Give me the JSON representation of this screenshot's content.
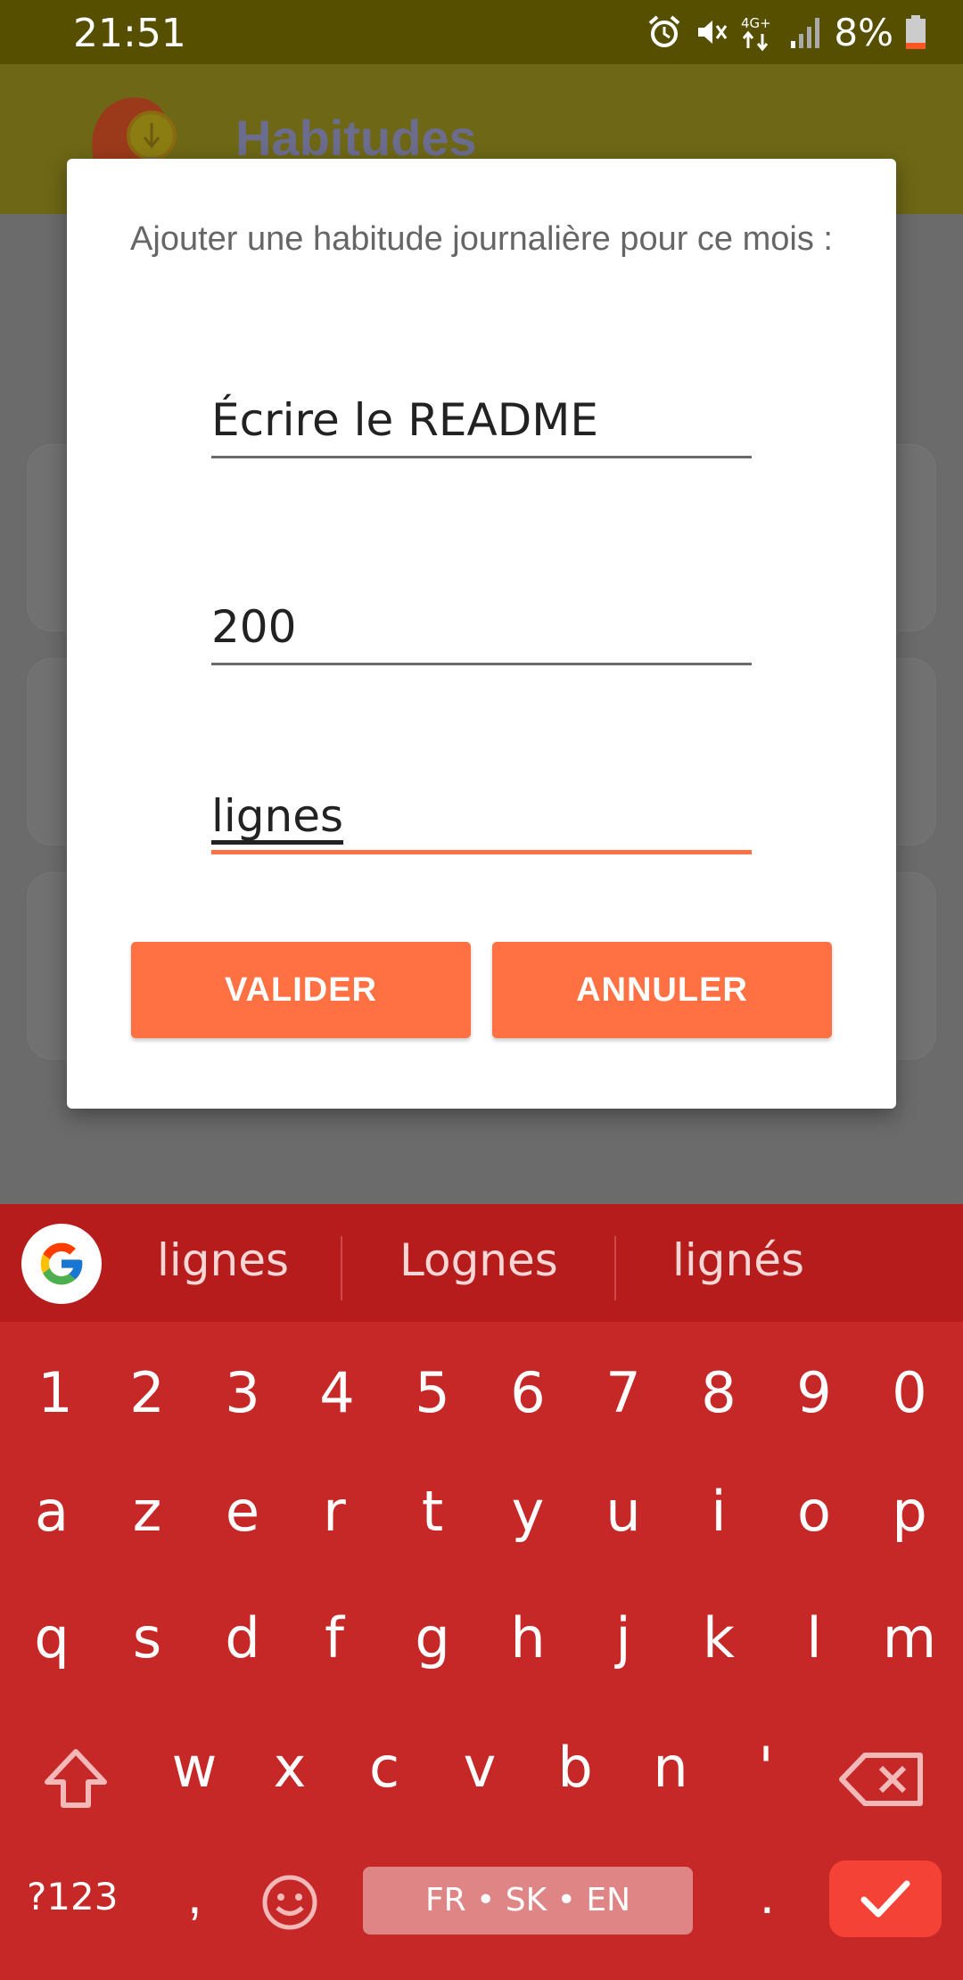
{
  "status_bar": {
    "time": "21:51",
    "network": "4G+",
    "battery": "8%"
  },
  "app_bar": {
    "title": "Habitudes"
  },
  "dialog": {
    "message": "Ajouter une habitude journalière pour ce mois :",
    "fields": [
      {
        "name": "habit-name",
        "value": "Écrire le README",
        "active": false
      },
      {
        "name": "habit-target",
        "value": "200",
        "active": false
      },
      {
        "name": "habit-unit",
        "value": "lignes",
        "active": true
      }
    ],
    "buttons": {
      "confirm": "VALIDER",
      "cancel": "ANNULER"
    }
  },
  "keyboard": {
    "suggestions": [
      "lignes",
      "Lognes",
      "lignés"
    ],
    "row_numbers": [
      "1",
      "2",
      "3",
      "4",
      "5",
      "6",
      "7",
      "8",
      "9",
      "0"
    ],
    "row1": [
      "a",
      "z",
      "e",
      "r",
      "t",
      "y",
      "u",
      "i",
      "o",
      "p"
    ],
    "row2": [
      "q",
      "s",
      "d",
      "f",
      "g",
      "h",
      "j",
      "k",
      "l",
      "m"
    ],
    "row3": [
      "w",
      "x",
      "c",
      "v",
      "b",
      "n",
      "'"
    ],
    "symbols_label": "?123",
    "comma": ",",
    "period": ".",
    "space_label": "FR • SK • EN"
  },
  "colors": {
    "status_bar": "#564f00",
    "accent": "#ff7043",
    "keyboard": "#c62828",
    "suggestion_bar": "#b71c1c"
  }
}
